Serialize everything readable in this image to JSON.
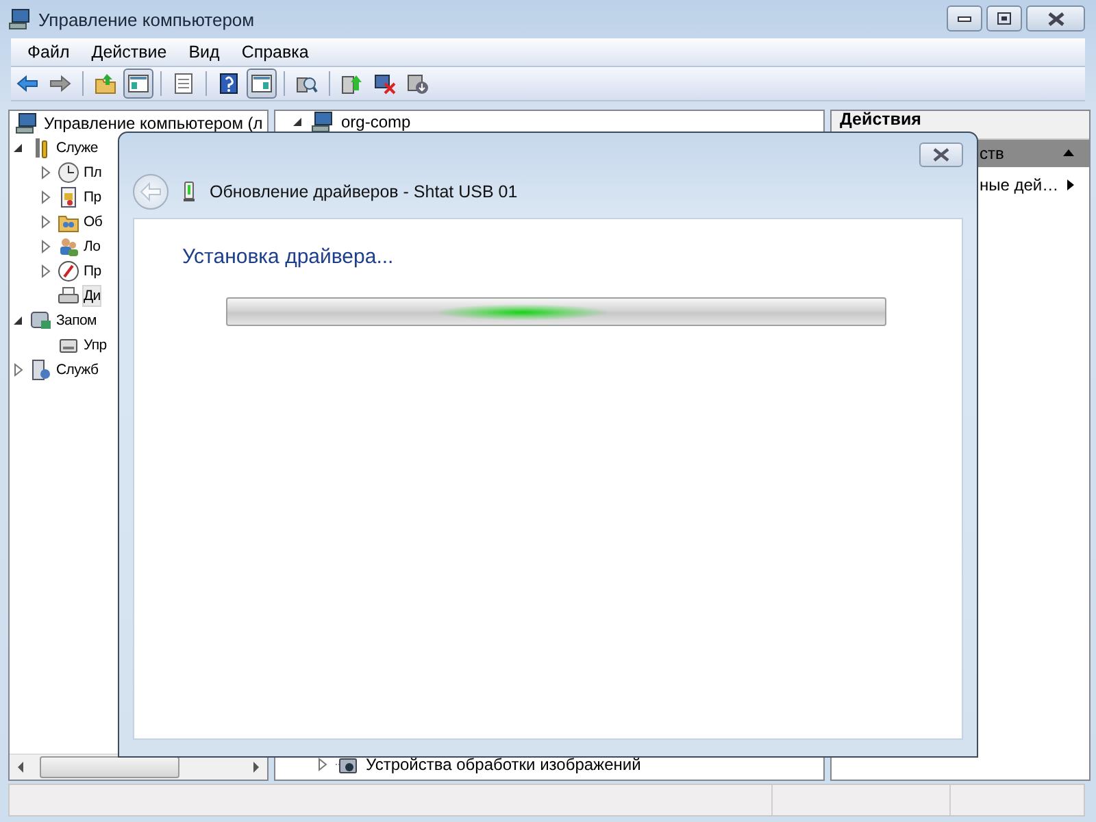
{
  "window": {
    "title": "Управление компьютером"
  },
  "menu": [
    {
      "label": "Файл"
    },
    {
      "label": "Действие"
    },
    {
      "label": "Вид"
    },
    {
      "label": "Справка"
    }
  ],
  "toolbar": [
    {
      "pressed": false
    },
    {
      "pressed": false
    },
    {
      "pressed": false
    },
    {
      "pressed": true
    },
    {
      "pressed": false
    },
    {
      "pressed": false
    },
    {
      "pressed": true
    },
    {
      "pressed": false
    },
    {
      "pressed": false
    },
    {
      "pressed": false
    },
    {
      "pressed": false
    }
  ],
  "tree": [
    {
      "label": "Управление компьютером (л",
      "selected": false,
      "children": [
        {
          "label": "Служе",
          "expanded": true,
          "selected": false,
          "children": [
            {
              "label": "Пл",
              "expanded": false,
              "selected": false
            },
            {
              "label": "Пр",
              "expanded": false,
              "selected": false
            },
            {
              "label": "Об",
              "expanded": false,
              "selected": false
            },
            {
              "label": "Ло",
              "expanded": false,
              "selected": false
            },
            {
              "label": "Пр",
              "expanded": false,
              "selected": false
            },
            {
              "label": "Ди",
              "selected": true
            }
          ]
        },
        {
          "label": "Запом",
          "expanded": true,
          "selected": false,
          "children": [
            {
              "label": "Упр",
              "selected": false
            }
          ]
        },
        {
          "label": "Служб",
          "expanded": false,
          "selected": false
        }
      ]
    }
  ],
  "center": {
    "root": {
      "label": "org-comp",
      "expanded": true
    },
    "bottom_item": {
      "label": "Устройства обработки изображений",
      "expanded": false
    }
  },
  "actions": {
    "title": "Действия",
    "section": {
      "label": "ств",
      "expanded": true
    },
    "items": [
      {
        "label": "ные дей…"
      }
    ]
  },
  "dialog": {
    "title": "Обновление драйверов - Shtat USB 01",
    "heading": "Установка драйвера...",
    "back": {
      "disabled": true
    },
    "progress": {
      "indeterminate": true
    }
  }
}
